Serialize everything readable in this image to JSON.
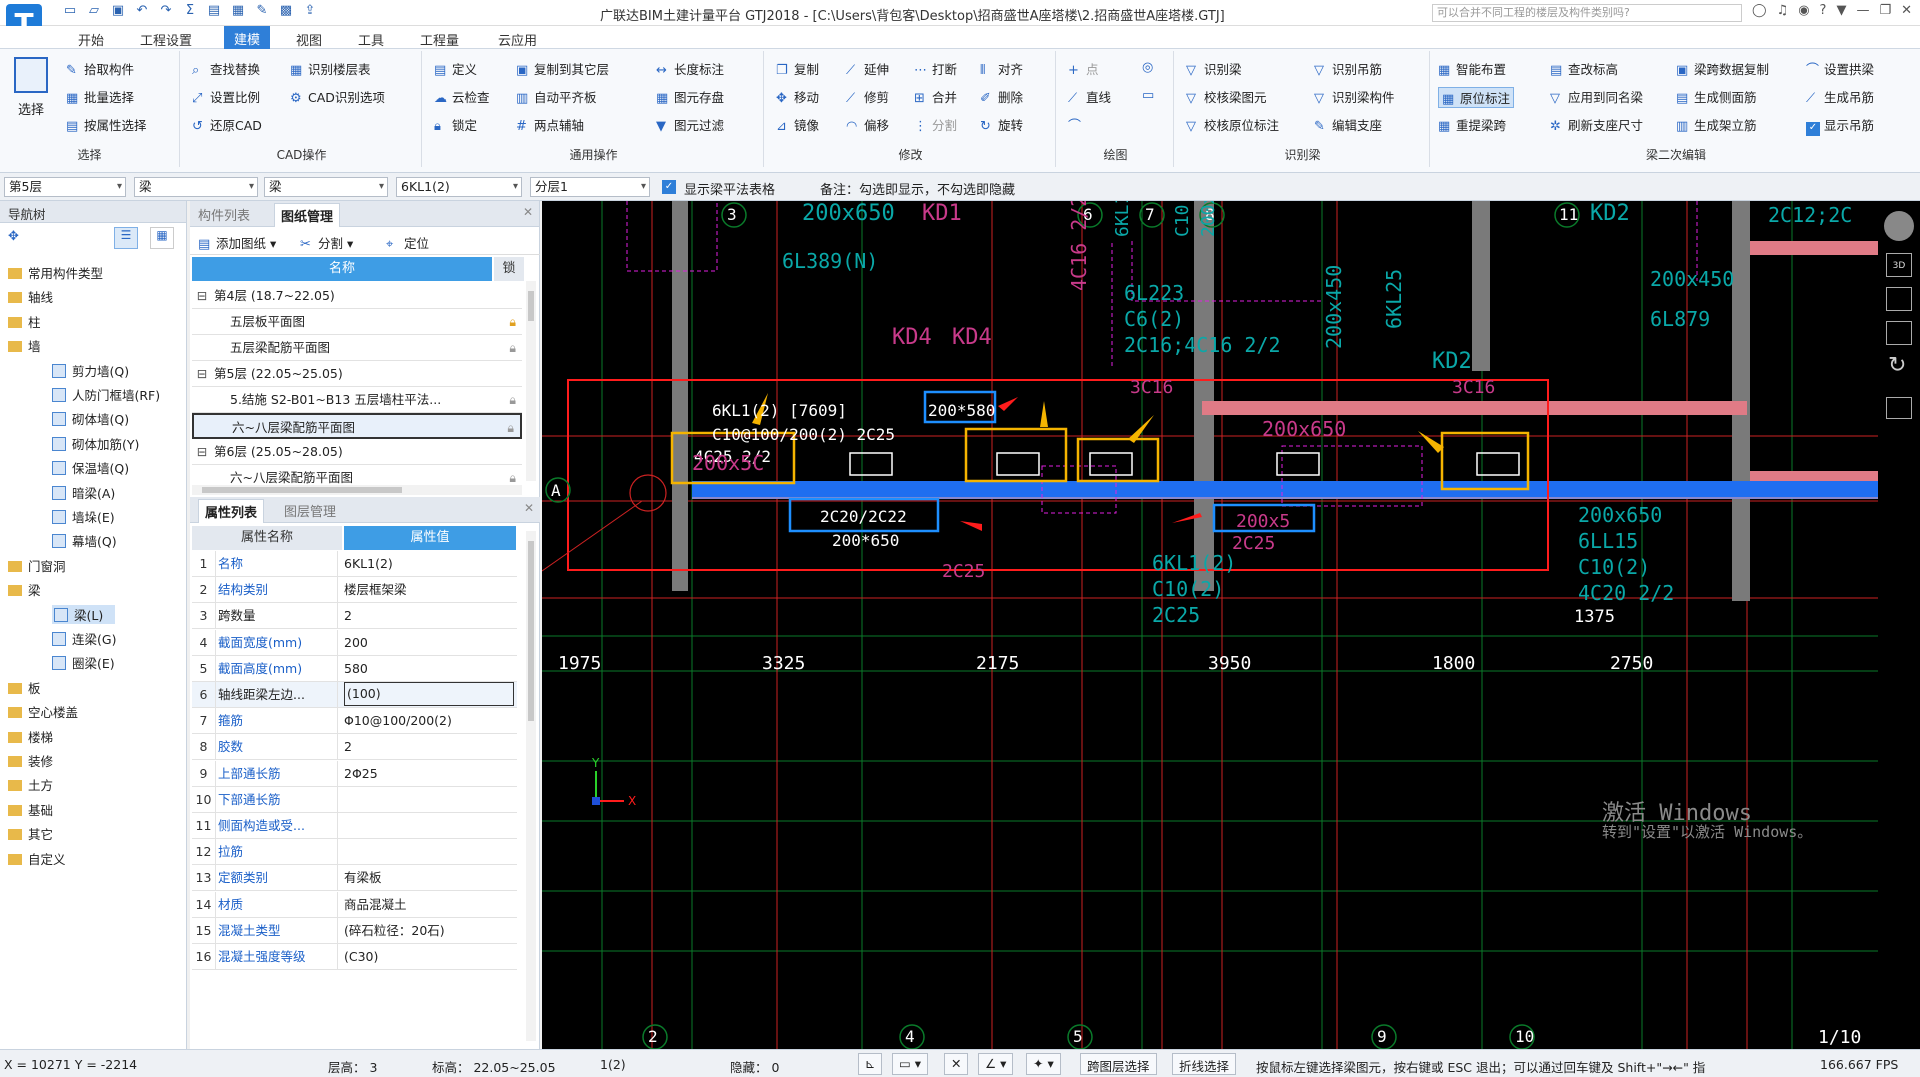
{
  "app": {
    "title": "广联达BIM土建计量平台 GTJ2018 - [C:\\Users\\背包客\\Desktop\\招商盛世A座塔楼\\2.招商盛世A座塔楼.GTJ]",
    "search_placeholder": "可以合并不同工程的楼层及构件类别吗?"
  },
  "menus": [
    "开始",
    "工程设置",
    "建模",
    "视图",
    "工具",
    "工程量",
    "云应用"
  ],
  "ribbon": {
    "select_big": "选择",
    "select_items": [
      "拾取构件",
      "批量选择",
      "按属性选择"
    ],
    "select_group": "选择",
    "cad_items": [
      "查找替换",
      "识别楼层表",
      "设置比例",
      "CAD识别选项",
      "还原CAD"
    ],
    "cad_group": "CAD操作",
    "general_items": [
      "定义",
      "复制到其它层",
      "长度标注",
      "云检查",
      "自动平齐板",
      "图元存盘",
      "锁定",
      "两点辅轴",
      "图元过滤"
    ],
    "general_group": "通用操作",
    "modify_items": [
      "复制",
      "延伸",
      "打断",
      "对齐",
      "移动",
      "修剪",
      "合并",
      "删除",
      "镜像",
      "偏移",
      "分割",
      "旋转"
    ],
    "modify_group": "修改",
    "draw_items": [
      "点",
      "直线"
    ],
    "draw_group": "绘图",
    "recog_items": [
      "识别梁",
      "识别吊筋",
      "校核梁图元",
      "识别梁构件",
      "校核原位标注",
      "编辑支座"
    ],
    "recog_group": "识别梁",
    "beam_items": [
      "智能布置",
      "查改标高",
      "梁跨数据复制",
      "设置拱梁",
      "原位标注",
      "应用到同名梁",
      "生成侧面筋",
      "生成吊筋",
      "重提梁跨",
      "刷新支座尺寸",
      "生成架立筋",
      "显示吊筋"
    ],
    "beam_group": "梁二次编辑"
  },
  "propbar": {
    "floor": "第5层",
    "type1": "梁",
    "type2": "梁",
    "element": "6KL1(2)",
    "layer": "分层1",
    "checkbox_label": "显示梁平法表格",
    "note": "备注：勾选即显示，不勾选即隐藏"
  },
  "nav": {
    "title": "导航树",
    "items": [
      {
        "label": "常用构件类型",
        "kind": "folder"
      },
      {
        "label": "轴线",
        "kind": "folder"
      },
      {
        "label": "柱",
        "kind": "folder"
      },
      {
        "label": "墙",
        "kind": "folder"
      },
      {
        "label": "剪力墙(Q)",
        "kind": "child"
      },
      {
        "label": "人防门框墙(RF)",
        "kind": "child"
      },
      {
        "label": "砌体墙(Q)",
        "kind": "child"
      },
      {
        "label": "砌体加筋(Y)",
        "kind": "child"
      },
      {
        "label": "保温墙(Q)",
        "kind": "child"
      },
      {
        "label": "暗梁(A)",
        "kind": "child"
      },
      {
        "label": "墙垛(E)",
        "kind": "child"
      },
      {
        "label": "幕墙(Q)",
        "kind": "child"
      },
      {
        "label": "门窗洞",
        "kind": "folder"
      },
      {
        "label": "梁",
        "kind": "folder"
      },
      {
        "label": "梁(L)",
        "kind": "child-selected"
      },
      {
        "label": "连梁(G)",
        "kind": "child"
      },
      {
        "label": "圈梁(E)",
        "kind": "child"
      },
      {
        "label": "板",
        "kind": "folder"
      },
      {
        "label": "空心楼盖",
        "kind": "folder"
      },
      {
        "label": "楼梯",
        "kind": "folder"
      },
      {
        "label": "装修",
        "kind": "folder"
      },
      {
        "label": "土方",
        "kind": "folder"
      },
      {
        "label": "基础",
        "kind": "folder"
      },
      {
        "label": "其它",
        "kind": "folder"
      },
      {
        "label": "自定义",
        "kind": "folder"
      }
    ]
  },
  "drawings": {
    "tabs": [
      "构件列表",
      "图纸管理"
    ],
    "toolbar": [
      "添加图纸",
      "分割",
      "定位"
    ],
    "head_name": "名称",
    "head_lock": "锁",
    "rows": [
      {
        "label": "第4层 (18.7~22.05)",
        "level": 0
      },
      {
        "label": "五层板平面图",
        "level": 1
      },
      {
        "label": "五层梁配筋平面图",
        "level": 1
      },
      {
        "label": "第5层 (22.05~25.05)",
        "level": 0
      },
      {
        "label": "5.结施 S2-B01~B13 五层墙柱平法...",
        "level": 1
      },
      {
        "label": "六~八层梁配筋平面图",
        "level": 1
      },
      {
        "label": "第6层 (25.05~28.05)",
        "level": 0
      },
      {
        "label": "六~八层梁配筋平面图",
        "level": 1
      }
    ]
  },
  "props": {
    "tabs": [
      "属性列表",
      "图层管理"
    ],
    "head_key": "属性名称",
    "head_val": "属性值",
    "rows": [
      {
        "n": "1",
        "k": "名称",
        "v": "6KL1(2)"
      },
      {
        "n": "2",
        "k": "结构类别",
        "v": "楼层框架梁"
      },
      {
        "n": "3",
        "k": "跨数量",
        "v": "2"
      },
      {
        "n": "4",
        "k": "截面宽度(mm)",
        "v": "200"
      },
      {
        "n": "5",
        "k": "截面高度(mm)",
        "v": "580"
      },
      {
        "n": "6",
        "k": "轴线距梁左边...",
        "v": "(100)"
      },
      {
        "n": "7",
        "k": "箍筋",
        "v": "Φ10@100/200(2)"
      },
      {
        "n": "8",
        "k": "胶数",
        "v": "2"
      },
      {
        "n": "9",
        "k": "上部通长筋",
        "v": "2Φ25"
      },
      {
        "n": "10",
        "k": "下部通长筋",
        "v": ""
      },
      {
        "n": "11",
        "k": "侧面构造或受...",
        "v": ""
      },
      {
        "n": "12",
        "k": "拉筋",
        "v": ""
      },
      {
        "n": "13",
        "k": "定额类别",
        "v": "有梁板"
      },
      {
        "n": "14",
        "k": "材质",
        "v": "商品混凝土"
      },
      {
        "n": "15",
        "k": "混凝土类型",
        "v": "(碎石粒径：20石)"
      },
      {
        "n": "16",
        "k": "混凝土强度等级",
        "v": "(C30)"
      }
    ]
  },
  "cad": {
    "axes_top": [
      "3",
      "6",
      "7",
      "8",
      "11"
    ],
    "axes_bottom": [
      "2",
      "4",
      "5",
      "9",
      "10"
    ],
    "axis_a": "A",
    "beam_label": "6KL1(2) [7609]",
    "beam_size": "200*580",
    "beam_stirrup": "C10@100/200(2) 2C25",
    "orig_left": "4C25 2/2",
    "orig_bottom_left": "2C20/2C22",
    "orig_bottom_left2": "200*650",
    "orig_bottom_right": "200x5",
    "orig_bottom_right2": "2C25",
    "dims": [
      "1975",
      "3325",
      "2175",
      "3950",
      "1800",
      "2750"
    ],
    "dim_right": "1375",
    "texts": [
      "200x650",
      "KD1",
      "6L389(N)",
      "KD4",
      "KD4",
      "4C16 2/2",
      "6L223",
      "C6(2)",
      "2C16;4C16 2/2",
      "200x450",
      "6KL25",
      "KD2",
      "3C16",
      "3C16",
      "200x650",
      "KD2",
      "200x450",
      "6L879",
      "2C12;2C",
      "6KL1(2)",
      "C10(2)",
      "2C25",
      "200x650",
      "6LL15",
      "C10(2)",
      "4C20 2/2",
      "200x5C",
      "2C25",
      "6KL1(2)",
      "C10(2)",
      "200x650"
    ],
    "page": "1/10",
    "watermark1": "激活 Windows",
    "watermark2": "转到\"设置\"以激活 Windows。"
  },
  "status": {
    "coords": "X = 10271 Y = -2214",
    "floor_h": "层高：  3",
    "elev": "标高：  22.05~25.05",
    "count": "1(2)",
    "hidden": "隐藏：  0",
    "btn1": "跨图层选择",
    "btn2": "折线选择",
    "hint": "按鼠标左键选择梁图元，按右键或 ESC 退出；可以通过回车键及 Shift+\"→←\" 指",
    "fps": "166.667 FPS"
  }
}
